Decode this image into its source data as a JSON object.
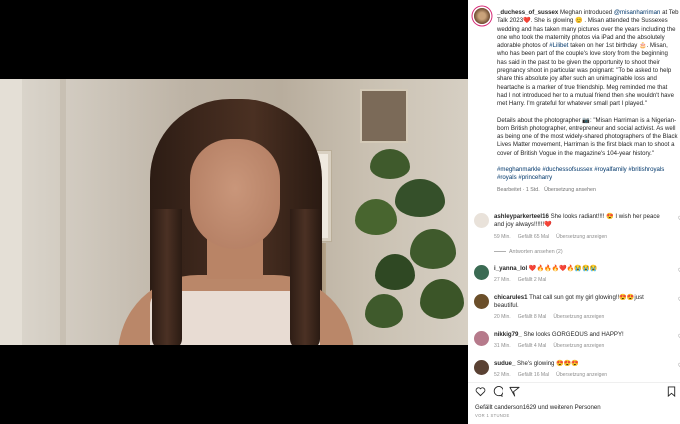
{
  "post": {
    "username": "_duchess_of_sussex",
    "caption_intro": " Meghan introduced ",
    "mention_1": "@misanharriman",
    "caption_1": " at Teb Talk 2023❤️. She is glowing 😊 . Misan attended the Sussexes wedding and has taken many pictures over the years including the one who took the maternity photos via iPad and the absolutely adorable photos of ",
    "mention_2": "#Lilibet",
    "caption_2": " taken on her 1st birthday 🎂. Misan, who has been part of the couple's love story from the beginning has said in the past to be given the opportunity to shoot their pregnancy shoot in particular was poignant: \"To be asked to help share this absolute joy after such an unimaginable loss and heartache is a marker of true friendship. Meg reminded me that had I not introduced her to a mutual friend then she wouldn't have met Harry. I'm grateful for whatever small part I played.\"",
    "caption_3": "Details about the photographer 📷: \"Misan Harriman is a Nigerian-born British photographer, entrepreneur and social activist. As well as being one of the most widely-shared photographers of the Black Lives Matter movement, Harriman is the first black man to shoot a cover of British Vogue in the magazine's 104-year history.\"",
    "hashtags": "#meghanmarkle #duchessofsussex #royalfamily #britishroyals #royals #princeharry",
    "edited": "Bearbeitet · 1 Std.",
    "see_translation": "Übersetzung ansehen"
  },
  "comments": [
    {
      "user": "ashleyparkerteel16",
      "text": " She looks radiant!!!! 😍 I wish her peace and joy always!!!!!!❤️",
      "time": "59 Min.",
      "likes": "Gefällt 65 Mal",
      "translate": "Übersetzung anzeigen",
      "avatar_color": "#e9e2da"
    },
    {
      "user": "i_yanna_lol",
      "text": " ❤️🔥🔥🔥❤️🔥😭😭😭",
      "time": "27 Min.",
      "likes": "Gefällt 2 Mal",
      "translate": "",
      "avatar_color": "#3b6b53"
    },
    {
      "user": "chicarules1",
      "text": " That call sun got my girl glowing!!😍😍just beautiful.",
      "time": "20 Min.",
      "likes": "Gefällt 8 Mal",
      "translate": "Übersetzung anzeigen",
      "avatar_color": "#6b4f2a"
    },
    {
      "user": "nikkig79_",
      "text": " She looks GORGEOUS and HAPPY!",
      "time": "31 Min.",
      "likes": "Gefällt 4 Mal",
      "translate": "Übersetzung anzeigen",
      "avatar_color": "#b67a8b"
    },
    {
      "user": "sudue_",
      "text": " She's glowing 😍😍😍",
      "time": "52 Min.",
      "likes": "Gefällt 16 Mal",
      "translate": "Übersetzung anzeigen",
      "avatar_color": "#5a4133"
    }
  ],
  "replies_toggle": "Antworten ansehen (2)",
  "footer": {
    "likes_text": "Gefällt canderson1629 und weiteren Personen",
    "time_ago": "VOR 1 STUNDE"
  },
  "icons": {
    "like": "heart-icon",
    "comment": "comment-icon",
    "share": "send-icon",
    "save": "bookmark-icon",
    "volume": "speaker-icon"
  },
  "colors": {
    "link": "#00376b",
    "muted": "#8e8e8e",
    "text": "#262626"
  }
}
